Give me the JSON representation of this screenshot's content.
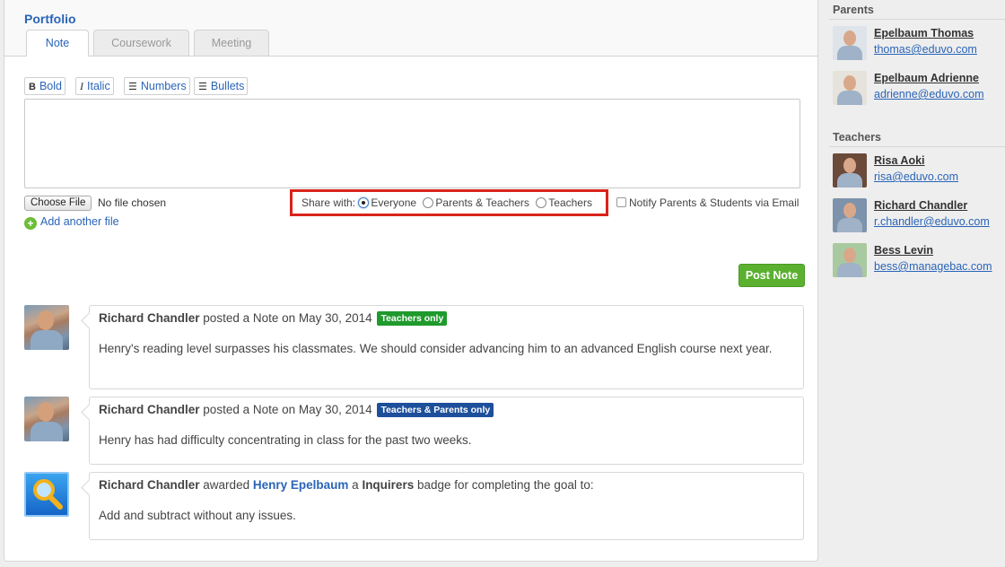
{
  "portfolio": {
    "title": "Portfolio",
    "tabs": [
      {
        "label": "Note",
        "active": true
      },
      {
        "label": "Coursework",
        "active": false
      },
      {
        "label": "Meeting",
        "active": false
      }
    ]
  },
  "editor": {
    "toolbar": [
      {
        "icon": "bold-icon",
        "glyph": "B",
        "label": "Bold"
      },
      {
        "icon": "italic-icon",
        "glyph": "I",
        "label": "Italic"
      },
      {
        "icon": "numbered-list-icon",
        "glyph": "☰",
        "label": "Numbers"
      },
      {
        "icon": "bulleted-list-icon",
        "glyph": "☰",
        "label": "Bullets"
      }
    ],
    "note_value": "",
    "file": {
      "choose_label": "Choose File",
      "status": "No file chosen",
      "add_another": "Add another file"
    },
    "share": {
      "label": "Share with:",
      "options": [
        {
          "label": "Everyone",
          "selected": true
        },
        {
          "label": "Parents & Teachers",
          "selected": false
        },
        {
          "label": "Teachers",
          "selected": false
        }
      ]
    },
    "notify_label": "Notify Parents & Students via Email",
    "notify_checked": false,
    "post_button": "Post Note"
  },
  "feed": [
    {
      "author": "Richard Chandler",
      "action": "posted a Note on May 30, 2014",
      "tag": "Teachers only",
      "tag_color": "#1f9a2c",
      "body": "Henry's reading level surpasses his classmates. We should consider advancing him to an advanced English course next year."
    },
    {
      "author": "Richard Chandler",
      "action": "posted a Note on May 30, 2014",
      "tag": "Teachers & Parents only",
      "tag_color": "#1d4f9b",
      "body": "Henry has had difficulty concentrating in class for the past two weeks."
    },
    {
      "author": "Richard Chandler",
      "verb": "awarded",
      "student": "Henry Epelbaum",
      "article": "a",
      "badge": "Inquirers",
      "rest": "badge for completing the goal to:",
      "body": "Add and subtract without any issues.",
      "icon": "magnifying-glass-badge-icon"
    }
  ],
  "sidebar": {
    "parents_heading": "Parents",
    "parents": [
      {
        "name": "Epelbaum Thomas",
        "email": "thomas@eduvo.com"
      },
      {
        "name": "Epelbaum Adrienne",
        "email": "adrienne@eduvo.com"
      }
    ],
    "teachers_heading": "Teachers",
    "teachers": [
      {
        "name": "Risa Aoki",
        "email": "risa@eduvo.com"
      },
      {
        "name": "Richard Chandler",
        "email": "r.chandler@eduvo.com"
      },
      {
        "name": "Bess Levin",
        "email": "bess@managebac.com"
      }
    ]
  },
  "colors": {
    "link": "#2a64b8",
    "post_button": "#5bb030",
    "highlight_box": "#d9241c"
  }
}
